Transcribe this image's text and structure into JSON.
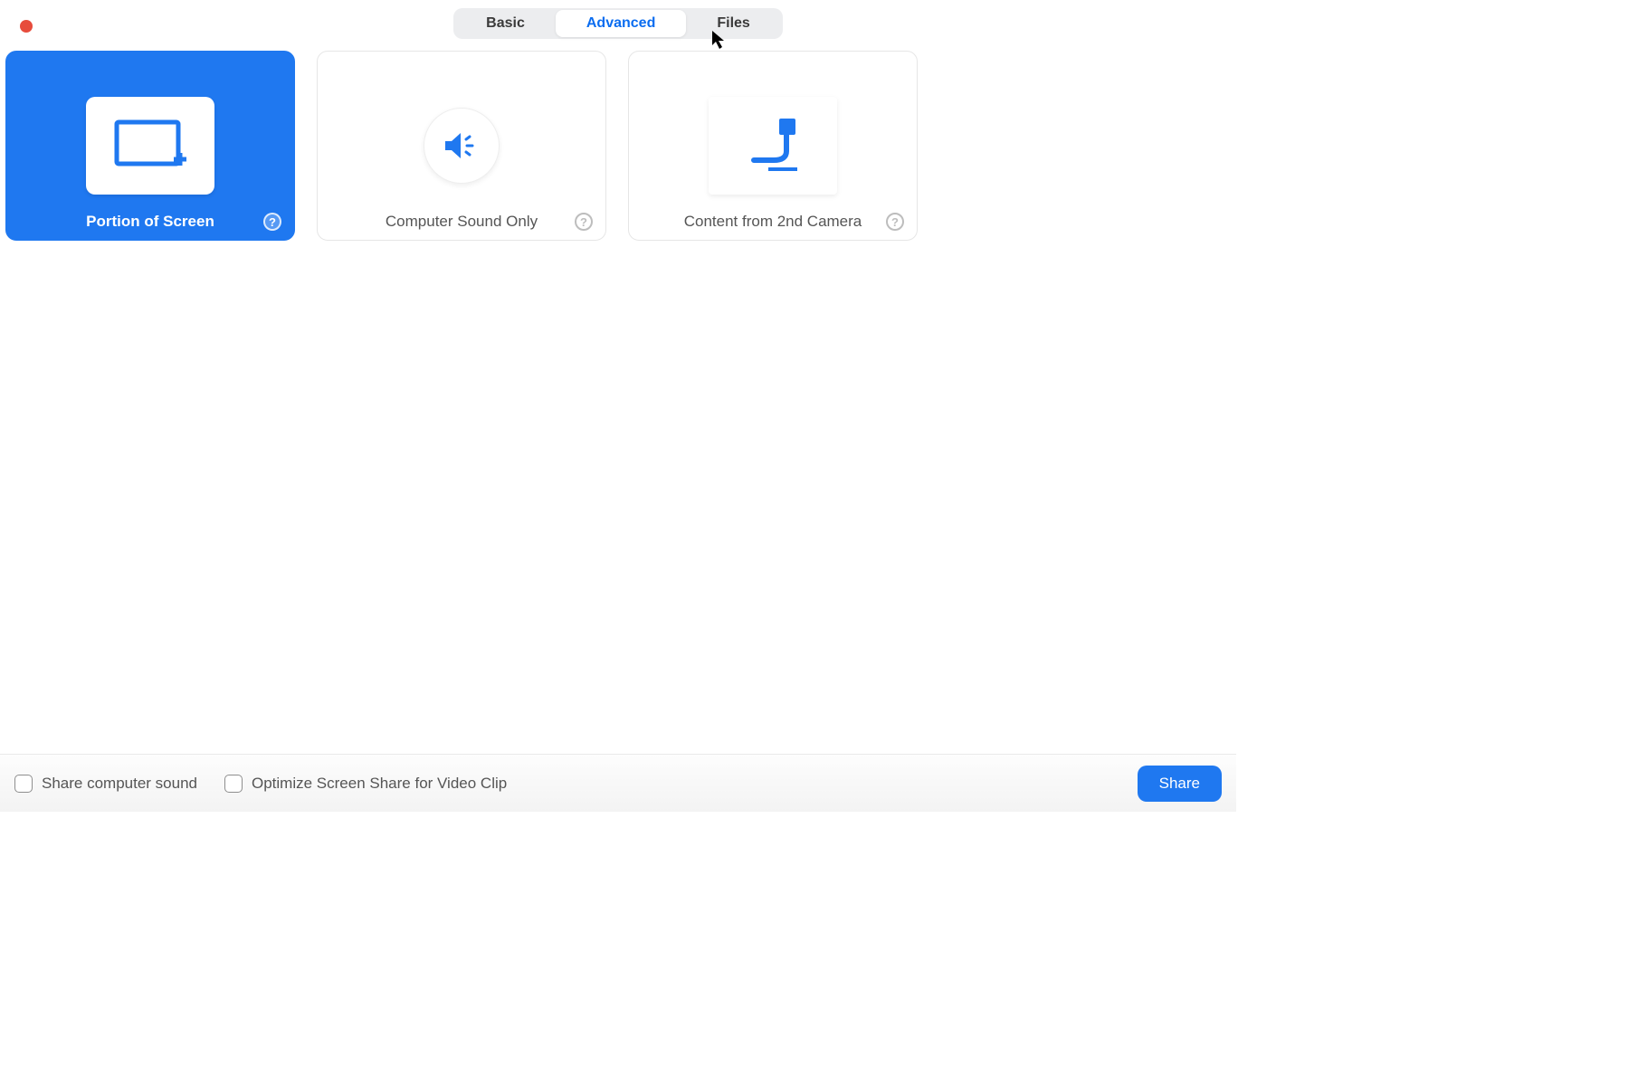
{
  "tabs": {
    "basic": "Basic",
    "advanced": "Advanced",
    "files": "Files",
    "active": "advanced"
  },
  "options": [
    {
      "id": "portion",
      "label": "Portion of Screen",
      "selected": true,
      "icon": "portion-of-screen-icon"
    },
    {
      "id": "sound",
      "label": "Computer Sound Only",
      "selected": false,
      "icon": "speaker-icon"
    },
    {
      "id": "camera2",
      "label": "Content from 2nd Camera",
      "selected": false,
      "icon": "second-camera-icon"
    }
  ],
  "footer": {
    "share_sound": "Share computer sound",
    "optimize": "Optimize Screen Share for Video Clip",
    "share_btn": "Share"
  },
  "colors": {
    "accent": "#1f78f0"
  }
}
